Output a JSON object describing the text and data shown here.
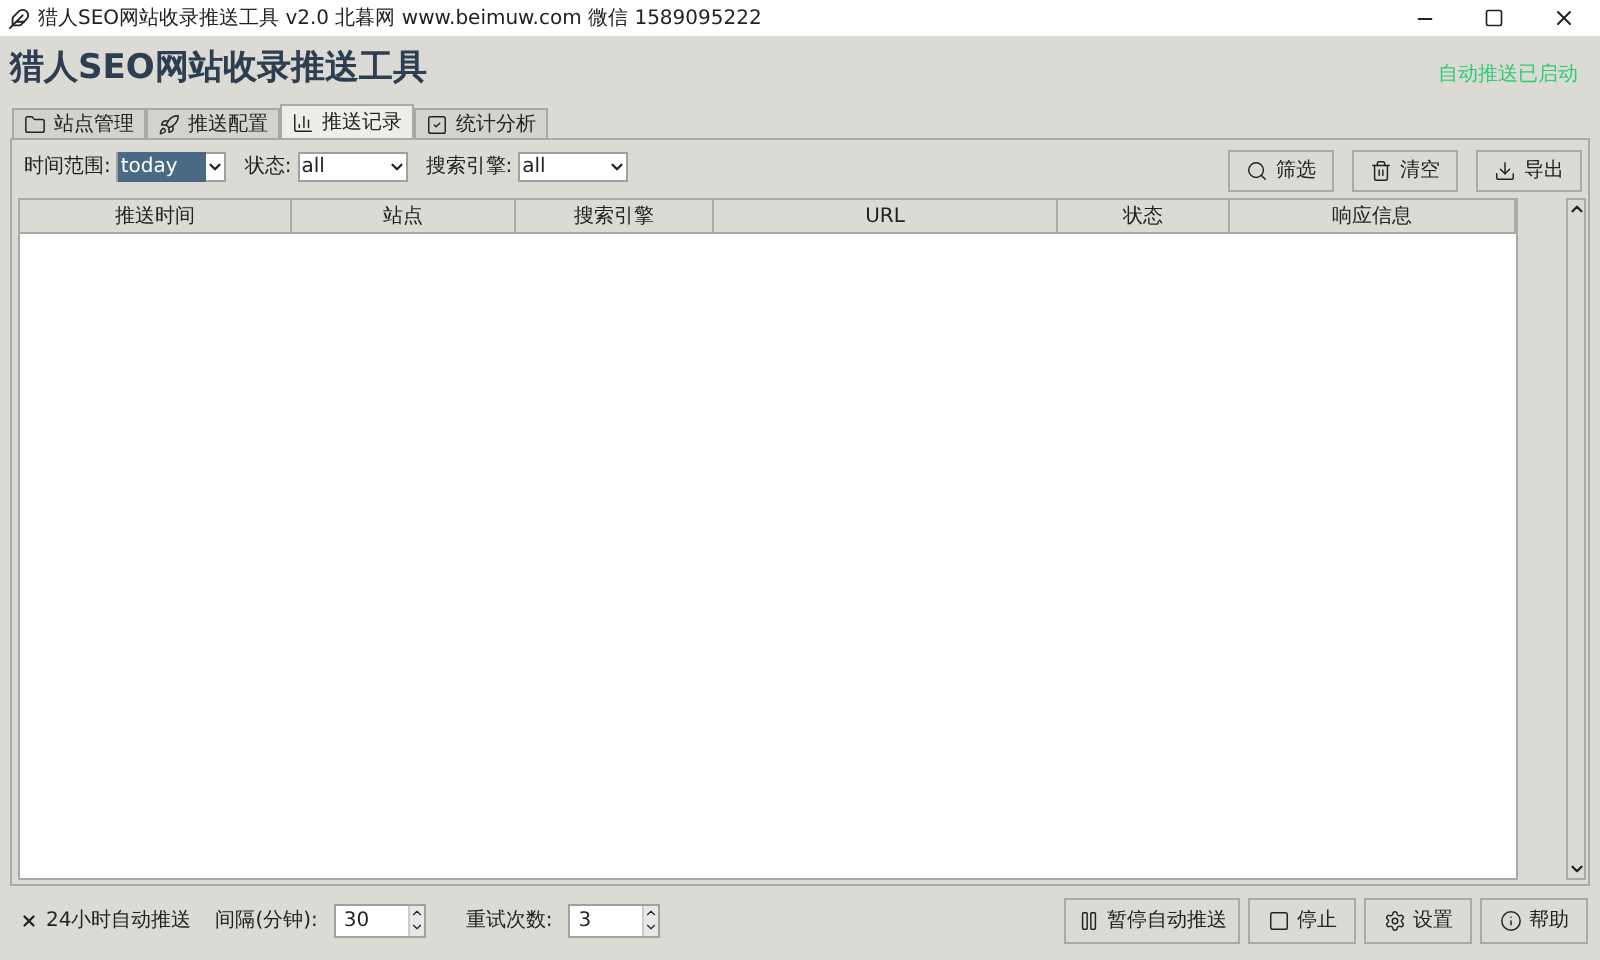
{
  "window": {
    "title": "猎人SEO网站收录推送工具 v2.0 北暮网 www.beimuw.com 微信 1589095222"
  },
  "header": {
    "title": "猎人SEO网站收录推送工具",
    "status": "自动推送已启动"
  },
  "tabs": [
    {
      "label": "站点管理",
      "selected": false
    },
    {
      "label": "推送配置",
      "selected": false
    },
    {
      "label": "推送记录",
      "selected": true
    },
    {
      "label": "统计分析",
      "selected": false
    }
  ],
  "filters": [
    {
      "label": "时间范围:",
      "value": "today",
      "focused": true
    },
    {
      "label": "状态:",
      "value": "all",
      "focused": false
    },
    {
      "label": "搜索引擎:",
      "value": "all",
      "focused": false
    }
  ],
  "actions": [
    {
      "label": "筛选"
    },
    {
      "label": "清空"
    },
    {
      "label": "导出"
    }
  ],
  "table": {
    "columns": [
      "推送时间",
      "站点",
      "搜索引擎",
      "URL",
      "状态",
      "响应信息"
    ]
  },
  "footer": {
    "auto_push": {
      "label": "24小时自动推送",
      "checked": true
    },
    "interval": {
      "label": "间隔(分钟):",
      "value": "30"
    },
    "retries": {
      "label": "重试次数:",
      "value": "3"
    },
    "buttons": [
      {
        "label": "暂停自动推送"
      },
      {
        "label": "停止"
      },
      {
        "label": "设置"
      },
      {
        "label": "帮助"
      }
    ]
  }
}
